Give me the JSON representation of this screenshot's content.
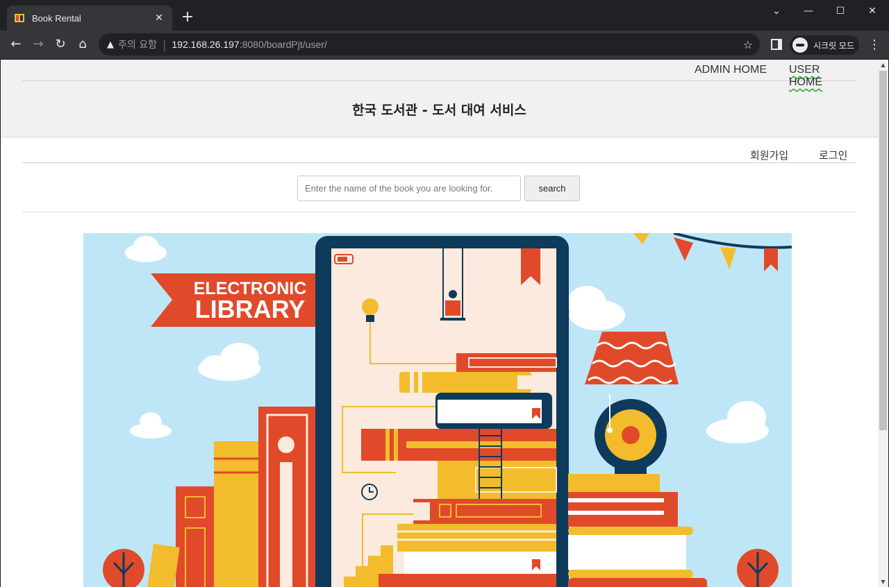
{
  "browser": {
    "tab_title": "Book Rental",
    "tab_close": "✕",
    "new_tab": "+",
    "window_controls": {
      "minimize": "—",
      "maximize": "☐",
      "close": "✕",
      "dropdown": "⌄"
    },
    "address": {
      "security_label": "주의 요함",
      "host": "192.168.26.197",
      "path": ":8080/boardPjt/user/"
    },
    "incognito_label": "시크릿 모드"
  },
  "page": {
    "admin_nav": {
      "admin_home": "ADMIN HOME",
      "user_home": "USER HOME"
    },
    "site_title": "한국 도서관 - 도서 대여 서비스",
    "user_nav": {
      "signup": "회원가입",
      "login": "로그인"
    },
    "search": {
      "placeholder": "Enter the name of the book you are looking for.",
      "button_label": "search"
    },
    "banner": {
      "ribbon_line1": "ELECTRONIC",
      "ribbon_line2": "LIBRARY"
    }
  },
  "colors": {
    "sky": "#bfe6f6",
    "red": "#e04a2a",
    "yellow": "#f2bc2c",
    "navy": "#0e3a5c",
    "cream": "#fbeadd"
  }
}
